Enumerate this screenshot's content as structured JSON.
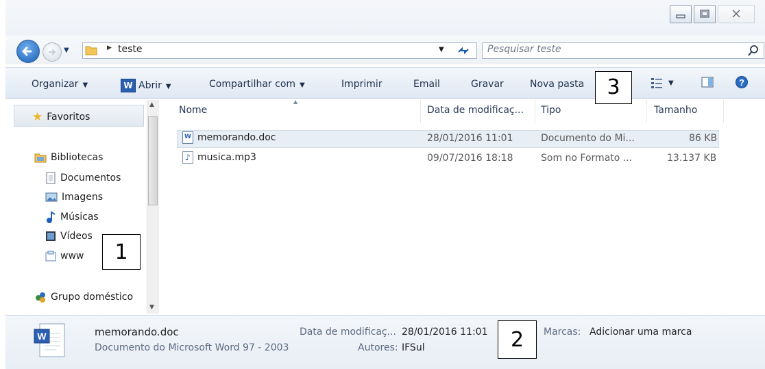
{
  "window": {
    "minimize_icon": "minimize-icon",
    "maximize_icon": "maximize-icon",
    "close_icon": "close-icon"
  },
  "address": {
    "path": "teste",
    "search_placeholder": "Pesquisar teste"
  },
  "toolbar": {
    "organizar": "Organizar",
    "abrir": "Abrir",
    "compartilhar": "Compartilhar com",
    "imprimir": "Imprimir",
    "email": "Email",
    "gravar": "Gravar",
    "nova_pasta": "Nova pasta"
  },
  "nav": {
    "favoritos": "Favoritos",
    "bibliotecas": "Bibliotecas",
    "documentos": "Documentos",
    "imagens": "Imagens",
    "musicas": "Músicas",
    "videos": "Vídeos",
    "www": "www",
    "grupo": "Grupo doméstico"
  },
  "columns": {
    "nome": "Nome",
    "data": "Data de modificaç...",
    "tipo": "Tipo",
    "tamanho": "Tamanho"
  },
  "files": [
    {
      "name": "memorando.doc",
      "date": "28/01/2016 11:01",
      "type": "Documento do Mi...",
      "size": "86 KB"
    },
    {
      "name": "musica.mp3",
      "date": "09/07/2016 18:18",
      "type": "Som no Formato ...",
      "size": "13.137 KB"
    }
  ],
  "details": {
    "filename": "memorando.doc",
    "filetype": "Documento do Microsoft Word 97 - 2003",
    "date_label": "Data de modificaç...",
    "date_value": "28/01/2016 11:01",
    "authors_label": "Autores:",
    "authors_value": "IFSul",
    "tags_label": "Marcas:",
    "tags_value": "Adicionar uma marca"
  },
  "callouts": {
    "one": "1",
    "two": "2",
    "three": "3"
  },
  "colors": {
    "toolbar_text": "#1d2f4a",
    "selected_row": "#e8eef6",
    "accent": "#2b6cc4"
  }
}
